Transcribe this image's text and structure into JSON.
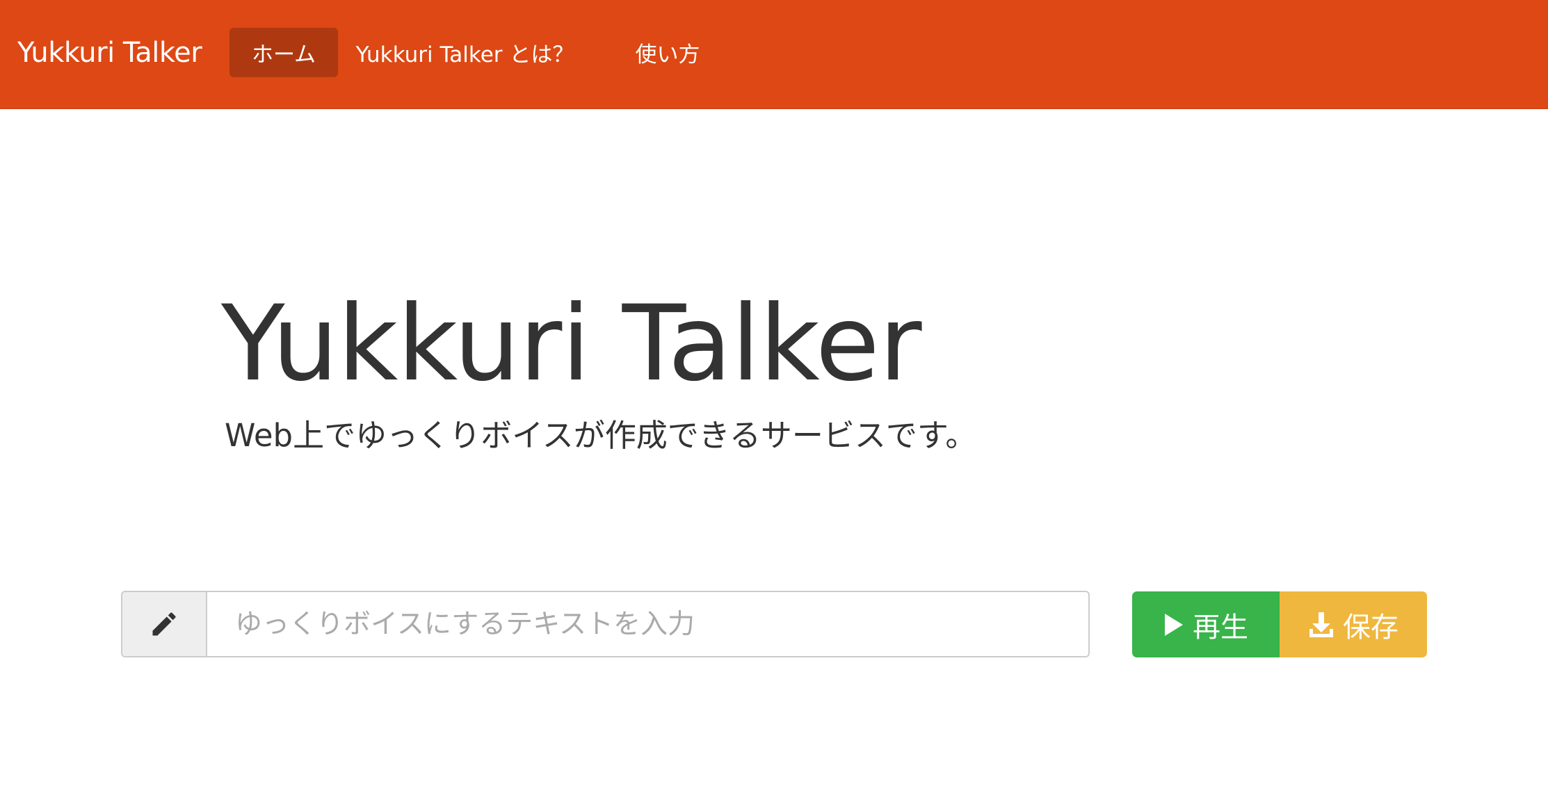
{
  "navbar": {
    "brand": "Yukkuri Talker",
    "items": [
      {
        "label": "ホーム",
        "active": true
      },
      {
        "label": "Yukkuri Talker とは？",
        "active": false
      },
      {
        "label": "使い方",
        "active": false
      }
    ],
    "color": "#dd4814",
    "active_color": "#ae3910"
  },
  "hero": {
    "title": "Yukkuri Talker",
    "subtitle": "Web上でゆっくりボイスが作成できるサービスです。"
  },
  "input": {
    "icon": "pencil-icon",
    "value": "",
    "placeholder": "ゆっくりボイスにするテキストを入力"
  },
  "actions": {
    "play_label": "再生",
    "play_icon": "play-icon",
    "play_color": "#38b44a",
    "save_label": "保存",
    "save_icon": "download-icon",
    "save_color": "#efb73e"
  }
}
